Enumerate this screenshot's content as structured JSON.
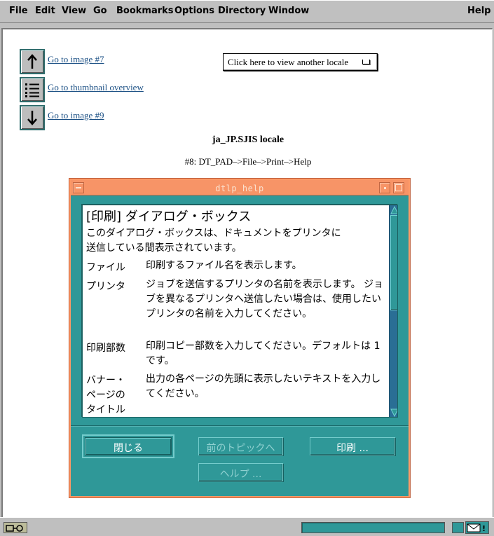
{
  "menubar": {
    "file": "File",
    "edit": "Edit",
    "view": "View",
    "go": "Go",
    "bookmarks": "Bookmarks",
    "options": "Options",
    "directory": "Directory",
    "window": "Window",
    "help": "Help"
  },
  "nav": {
    "prev_link": "Go to image #7",
    "thumbnail_link": "Go to thumbnail overview ",
    "next_link": "Go to image #9",
    "locale_button": "Click here to view another locale"
  },
  "page": {
    "locale_title": "ja_JP.SJIS locale",
    "caption": "#8: DT_PAD–>File–>Print–>Help"
  },
  "dialog": {
    "title": "dtlp_help",
    "heading": "[印刷] ダイアログ・ボックス",
    "intro_line1": "このダイアログ・ボックスは、ドキュメントをプリンタに",
    "intro_line2": "送信している間表示されています。",
    "items": [
      {
        "term": "ファイル",
        "def": "印刷するファイル名を表示します。"
      },
      {
        "term": "プリンタ",
        "def": "ジョブを送信するプリンタの名前を表示します。 ジョブを異なるプリンタへ送信したい場合は、使用したいプリンタの名前を入力してください。"
      },
      {
        "term": "印刷部数",
        "def": "印刷コピー部数を入力してください。デフォルトは 1 です。"
      },
      {
        "term": "バナー・ページのタイトル",
        "def": "出力の各ページの先頭に表示したいテキストを入力してください。"
      }
    ],
    "buttons": {
      "close": "閉じる",
      "prev_topic": "前のトピックへ",
      "print": "印刷 ...",
      "help": "ヘルプ ..."
    }
  },
  "colors": {
    "dialog_bg": "#2f9898",
    "titlebar": "#f79467",
    "link": "#1a4f84",
    "scrollbar": "#2a6e95"
  }
}
